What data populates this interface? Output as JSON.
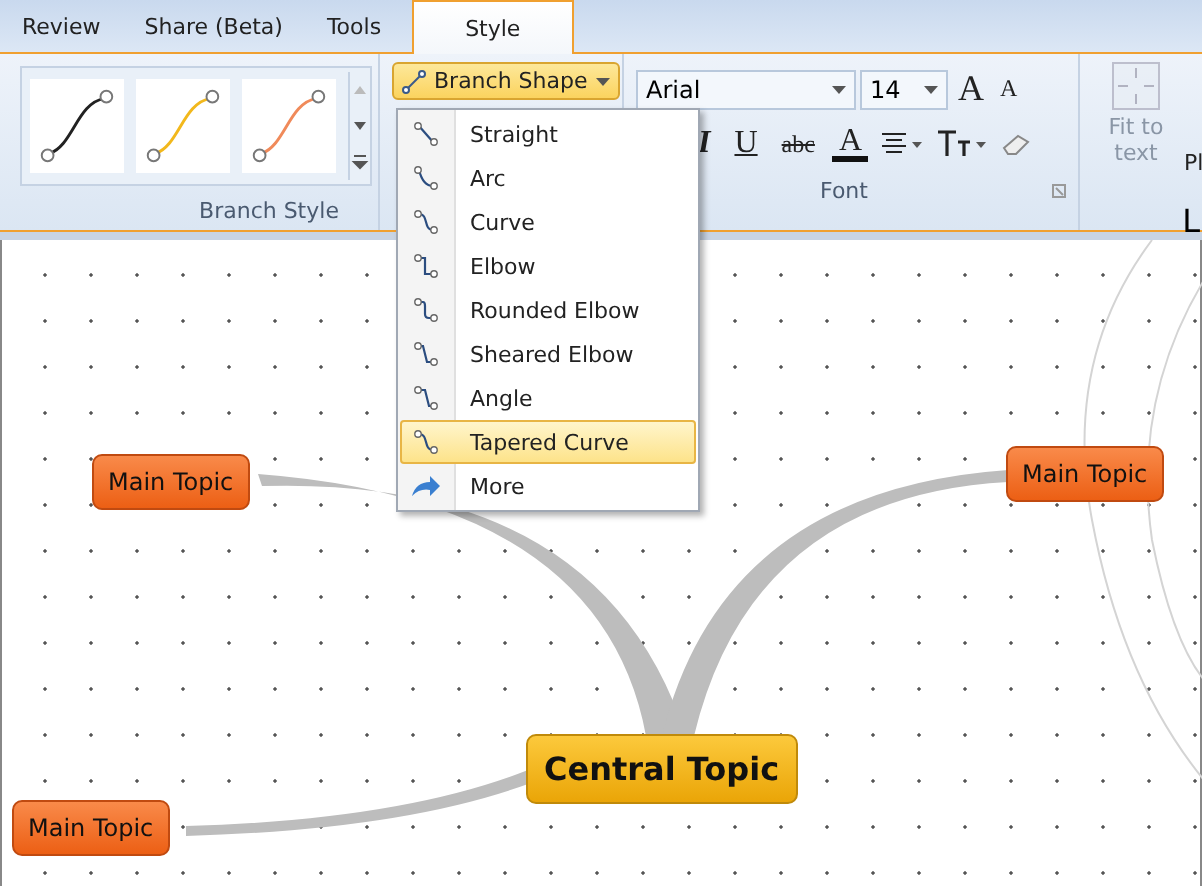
{
  "tabs": [
    {
      "label": "Review",
      "selected": false
    },
    {
      "label": "Share (Beta)",
      "selected": false
    },
    {
      "label": "Tools",
      "selected": false
    },
    {
      "label": "Style",
      "selected": true
    }
  ],
  "branch_style": {
    "presets": [
      {
        "color": "#222222"
      },
      {
        "color": "#f2b81c"
      },
      {
        "color": "#f08a5a"
      }
    ],
    "label": "Branch Style"
  },
  "branch_shape_button": {
    "label": "Branch Shape",
    "expanded": true
  },
  "branch_shape_menu": [
    {
      "kind": "shape",
      "label": "Straight",
      "selected": false
    },
    {
      "kind": "shape",
      "label": "Arc",
      "selected": false
    },
    {
      "kind": "shape",
      "label": "Curve",
      "selected": false
    },
    {
      "kind": "shape",
      "label": "Elbow",
      "selected": false
    },
    {
      "kind": "shape",
      "label": "Rounded Elbow",
      "selected": false
    },
    {
      "kind": "shape",
      "label": "Sheared Elbow",
      "selected": false
    },
    {
      "kind": "shape",
      "label": "Angle",
      "selected": false
    },
    {
      "kind": "shape",
      "label": "Tapered Curve",
      "selected": true
    },
    {
      "kind": "more",
      "label": "More",
      "selected": false
    }
  ],
  "font": {
    "family": "Arial",
    "size": "14",
    "grow": "A",
    "shrink": "A",
    "buttons": [
      {
        "kind": "italic",
        "text": "I"
      },
      {
        "kind": "underline",
        "text": "U"
      },
      {
        "kind": "strike",
        "text": "abc"
      },
      {
        "kind": "color",
        "text": "A"
      }
    ],
    "label": "Font"
  },
  "fit_to_text": {
    "label": "Fit to text",
    "disabled": true
  },
  "cut_off": {
    "next_button": "Pl",
    "next_group": "L"
  },
  "topics": [
    {
      "kind": "main",
      "text": "Main Topic"
    },
    {
      "kind": "main",
      "text": "Main Topic"
    },
    {
      "kind": "central",
      "text": "Central Topic"
    },
    {
      "kind": "main",
      "text": "Main Topic"
    }
  ]
}
